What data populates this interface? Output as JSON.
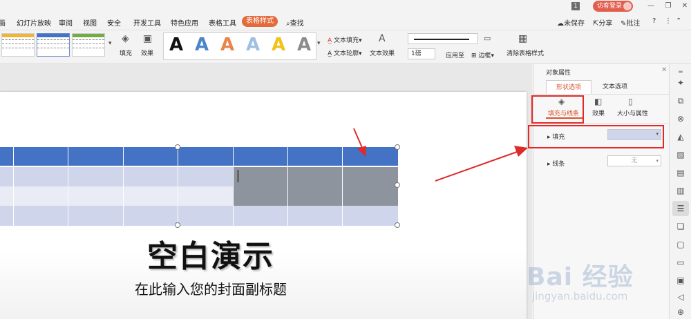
{
  "titlebar": {
    "badge": "1",
    "visitor_login": "访客登录",
    "minimize": "—",
    "restore": "❐",
    "close": "✕"
  },
  "menu": {
    "items": [
      "画",
      "幻灯片放映",
      "审阅",
      "视图",
      "安全",
      "开发工具",
      "特色应用",
      "表格工具",
      "表格样式"
    ],
    "search": "查找",
    "right": {
      "unsaved": "未保存",
      "share": "分享",
      "comment": "批注",
      "help": "?"
    }
  },
  "ribbon": {
    "fill_label": "填充",
    "effect_label": "效果",
    "wordart_glyph": "A",
    "text_fill": "文本填充",
    "text_outline": "文本轮廓",
    "text_effect": "文本效果",
    "line_weight": "1磅",
    "apply_to": "应用至",
    "border": "边框",
    "clear_table_style": "清除表格样式"
  },
  "slide": {
    "title": "空白演示",
    "subtitle": "在此输入您的封面副标题"
  },
  "pane": {
    "title": "对象属性",
    "tabs": [
      "形状选项",
      "文本选项"
    ],
    "subtabs": [
      "填充与线条",
      "效果",
      "大小与属性"
    ],
    "fill_label": "填充",
    "line_label": "线条",
    "line_value": "无"
  },
  "colors": {
    "accent_orange": "#e46a3b",
    "table_header": "#4472c4",
    "table_row": "#cfd5ea",
    "table_row_alt": "#e9ebf5",
    "selected_cells": "#8e949e",
    "annotation_red": "#e02a2a"
  },
  "watermark": {
    "brand": "Bai 经验",
    "url": "jingyan.baidu.com"
  }
}
